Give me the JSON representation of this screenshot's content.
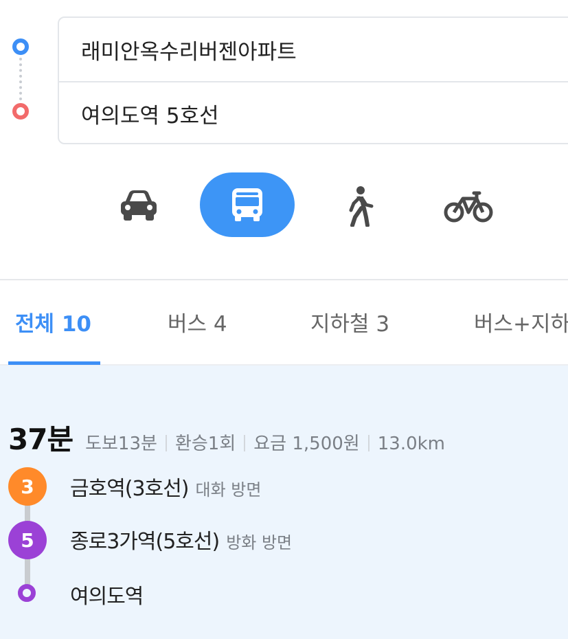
{
  "route": {
    "origin": "래미안옥수리버젠아파트",
    "destination": "여의도역 5호선"
  },
  "modes": [
    {
      "name": "car-icon",
      "selected": false
    },
    {
      "name": "bus-icon",
      "selected": true
    },
    {
      "name": "walk-icon",
      "selected": false
    },
    {
      "name": "bike-icon",
      "selected": false
    }
  ],
  "tabs": [
    {
      "label": "전체 10",
      "active": true
    },
    {
      "label": "버스 4",
      "active": false
    },
    {
      "label": "지하철 3",
      "active": false
    },
    {
      "label": "버스+지하",
      "active": false
    }
  ],
  "result": {
    "duration": "37분",
    "walk": "도보13분",
    "transfers": "환승1회",
    "fare": "요금 1,500원",
    "distance": "13.0km",
    "steps": [
      {
        "line": "3",
        "line_color": "#ff8a2a",
        "station": "금호역(3호선)",
        "direction": "대화 방면"
      },
      {
        "line": "5",
        "line_color": "#9b41d6",
        "station": "종로3가역(5호선)",
        "direction": "방화 방면"
      },
      {
        "line": "",
        "line_color": "#9b41d6",
        "station": "여의도역",
        "direction": ""
      }
    ]
  },
  "colors": {
    "accent": "#3d8ff6",
    "origin_marker": "#3d8ff6",
    "destination_marker": "#f26b6b",
    "panel_bg": "#edf5fd"
  }
}
